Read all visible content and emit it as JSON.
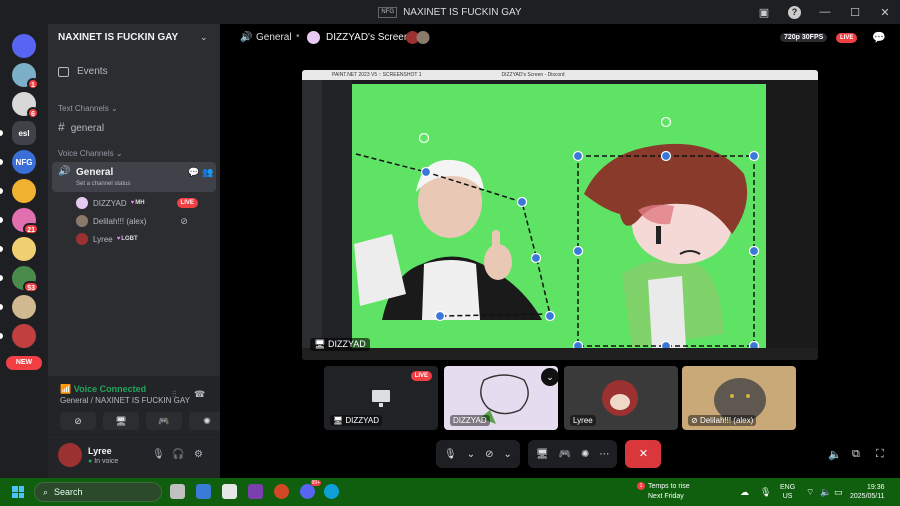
{
  "window": {
    "title": "NAXINET IS FUCKIN GAY",
    "app_icon_label": "NFG"
  },
  "servers": [
    {
      "name": "discord-home",
      "color": "#5865f2",
      "label": ""
    },
    {
      "name": "server-1",
      "color": "#7bb0c8",
      "label": "",
      "badge": "1"
    },
    {
      "name": "server-2",
      "color": "#d8d8d8",
      "label": "",
      "badge": "6"
    },
    {
      "name": "server-esl",
      "color": "#404249",
      "label": "esl"
    },
    {
      "name": "server-nfg",
      "color": "#3a6fd8",
      "label": "NFG"
    },
    {
      "name": "server-6",
      "color": "#f0b030",
      "label": ""
    },
    {
      "name": "server-7",
      "color": "#e070b0",
      "label": "",
      "badge": "21"
    },
    {
      "name": "server-8",
      "color": "#f0d070",
      "label": ""
    },
    {
      "name": "server-9",
      "color": "#4a8a4a",
      "label": "",
      "badge": "53"
    },
    {
      "name": "server-10",
      "color": "#d0b890",
      "label": ""
    },
    {
      "name": "server-11",
      "color": "#c04040",
      "label": ""
    }
  ],
  "new_label": "NEW",
  "sidebar": {
    "server_name": "NAXINET IS FUCKIN GAY",
    "events": "Events",
    "text_category": "Text Channels",
    "text_channel": "general",
    "voice_category": "Voice Channels",
    "voice_channel": "General",
    "channel_status": "Set a channel status",
    "voice_users": [
      {
        "name": "DIZZYAD",
        "tag": "MH",
        "live": "LIVE",
        "color": "#e8c9f2"
      },
      {
        "name": "Delilah!!! (alex)",
        "tag": "",
        "color": "#8a7a6a"
      },
      {
        "name": "Lyree",
        "tag": "LGBT",
        "color": "#9b3131"
      }
    ]
  },
  "voice_panel": {
    "status": "Voice Connected",
    "channel": "General / NAXINET IS FUCKIN GAY"
  },
  "user": {
    "name": "Lyree",
    "status": "In voice"
  },
  "stage": {
    "channel": "General",
    "screen_title": "DIZZYAD's Screen",
    "quality": "720p 30FPS",
    "live": "LIVE",
    "stream_label": "DIZZYAD",
    "inner_title": "PAINT.NET 2023 V5 :: SCREENSHOT 1",
    "inner_app_title": "DIZZYAD's Screen  - Discord"
  },
  "tiles": [
    {
      "name": "DIZZYAD",
      "live": "LIVE",
      "bg": "#202225"
    },
    {
      "name": "DIZZYAD",
      "bg": "#e6dcef"
    },
    {
      "name": "Lyree",
      "bg": "#3a3a3a"
    },
    {
      "name": "Delilah!!! (alex)",
      "bg": "#c9a978"
    }
  ],
  "taskbar": {
    "search": "Search",
    "weather_title": "Temps to rise",
    "weather_sub": "Next Friday",
    "weather_badge": "1",
    "lang1": "ENG",
    "lang2": "US",
    "time": "19:36",
    "date": "2025/05/11",
    "discord_badge": "99+"
  }
}
